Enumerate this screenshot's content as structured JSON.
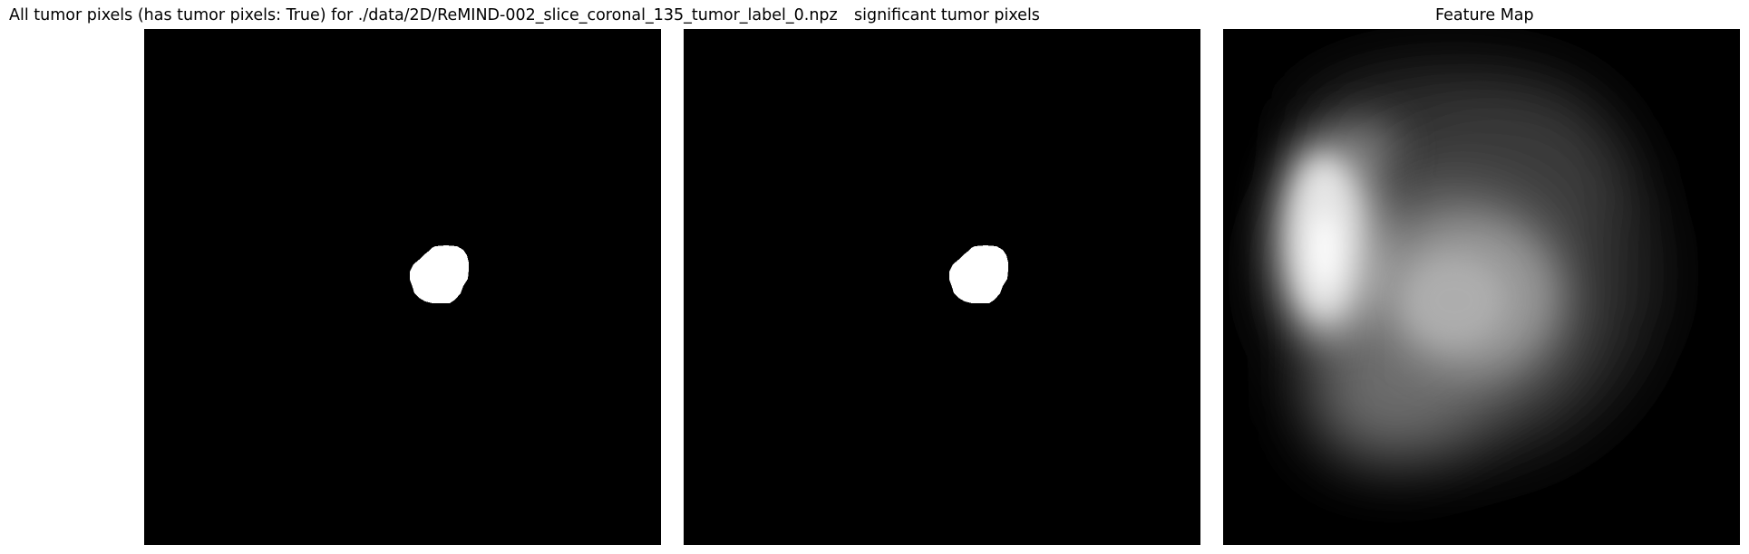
{
  "panels": [
    {
      "title": "All tumor pixels (has tumor pixels: True) for ./data/2D/ReMIND-002_slice_coronal_135_tumor_label_0.npz",
      "image": "binary tumor mask: white blob on black background"
    },
    {
      "title": "significant tumor pixels",
      "image": "binary significant-pixel mask: white blob on black background"
    },
    {
      "title": "Feature Map",
      "image": "blurred grayscale feature map"
    }
  ],
  "colors": {
    "background": "#000000",
    "mask": "#ffffff",
    "page": "#ffffff"
  }
}
